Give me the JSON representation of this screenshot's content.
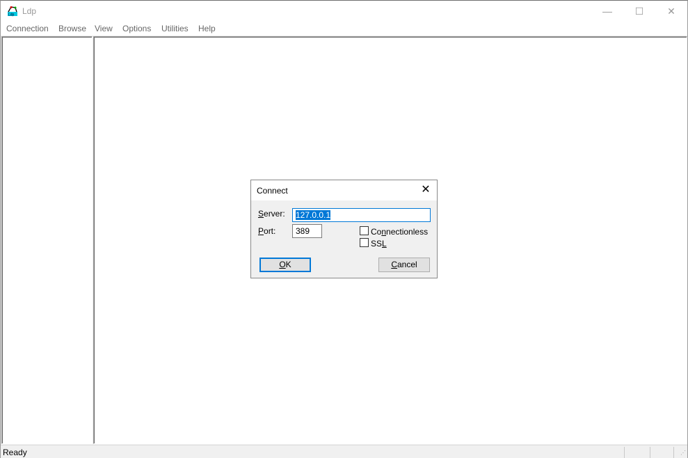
{
  "window": {
    "title": "Ldp",
    "minimize": "—",
    "maximize": "☐",
    "close": "✕"
  },
  "menu": [
    "Connection",
    "Browse",
    "View",
    "Options",
    "Utilities",
    "Help"
  ],
  "status": {
    "text": "Ready"
  },
  "dialog": {
    "title": "Connect",
    "close": "✕",
    "server_label_u": "S",
    "server_label_rest": "erver:",
    "server_value": "127.0.0.1",
    "port_label_u": "P",
    "port_label_rest": "ort:",
    "port_value": "389",
    "connectionless_a": "Co",
    "connectionless_u": "n",
    "connectionless_b": "nectionless",
    "connectionless_checked": false,
    "ssl_a": "SS",
    "ssl_u": "L",
    "ssl_checked": false,
    "ok_u": "O",
    "ok_rest": "K",
    "cancel_u": "C",
    "cancel_rest": "ancel"
  }
}
